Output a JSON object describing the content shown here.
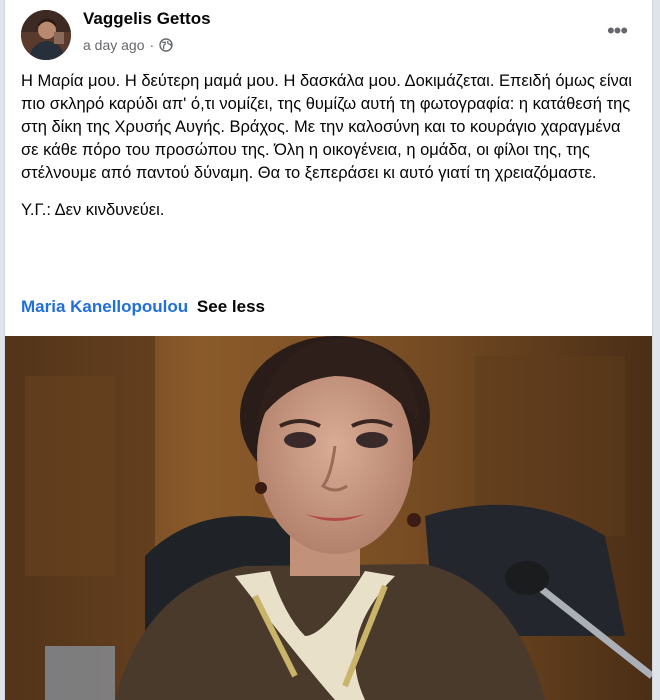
{
  "post": {
    "author": "Vaggelis Gettos",
    "timestamp": "a day ago",
    "separator": "·",
    "privacy_icon": "globe-icon",
    "more_icon": "more-options-icon",
    "more_label": "•••",
    "paragraph_1": "Η Μαρία μου. Η δεύτερη μαμά μου. Η δασκάλα μου. Δοκιμάζεται. Επειδή όμως είναι πιο σκληρό καρύδι απ' ό,τι νομίζει, της θυμίζω αυτή τη φωτογραφία: η κατάθεσή της στη δίκη της Χρυσής Αυγής. Βράχος. Με την καλοσύνη και το κουράγιο χαραγμένα σε κάθε πόρο του προσώπου της. Όλη η οικογένεια, η ομάδα, οι φίλοι της, της στέλνουμε από παντού δύναμη. Θα το ξεπεράσει κι αυτό γιατί τη χρειαζόμαστε.",
    "paragraph_2": "Υ.Γ.: Δεν κινδυνεύει.",
    "tagged_person": "Maria Kanellopoulou",
    "see_less": "See less"
  },
  "colors": {
    "link": "#216fdb",
    "text": "#050505",
    "secondary": "#65676b"
  }
}
